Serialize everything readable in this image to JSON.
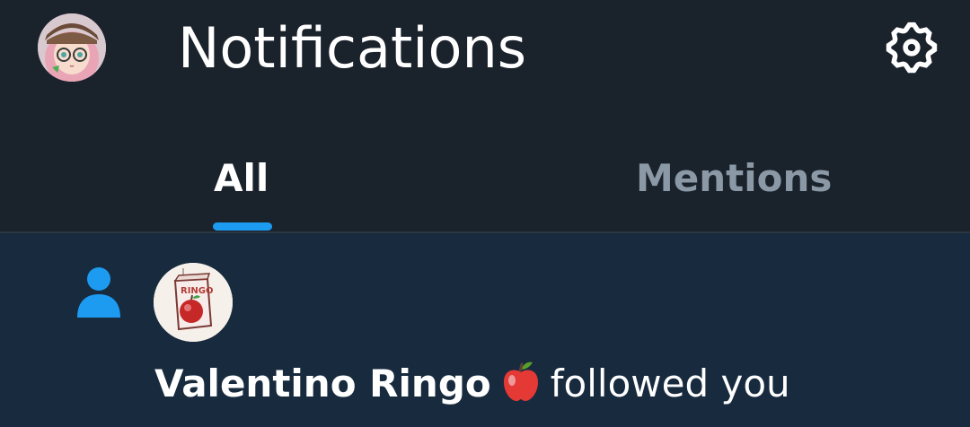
{
  "header": {
    "title": "Notifications",
    "avatar_icon": "user-avatar",
    "settings_icon": "gear-icon"
  },
  "tabs": [
    {
      "label": "All",
      "active": true
    },
    {
      "label": "Mentions",
      "active": false
    }
  ],
  "colors": {
    "accent": "#1d9bf0",
    "header_bg": "#1a222c",
    "notification_bg": "#172a3e",
    "inactive_tab": "#8b98a5"
  },
  "notifications": [
    {
      "type_icon": "person-icon",
      "avatar_icon": "ringo-juice-box-avatar",
      "avatar_text": "RINGO",
      "user_name": "Valentino Ringo",
      "emoji": "🍎",
      "action": "followed you"
    }
  ]
}
